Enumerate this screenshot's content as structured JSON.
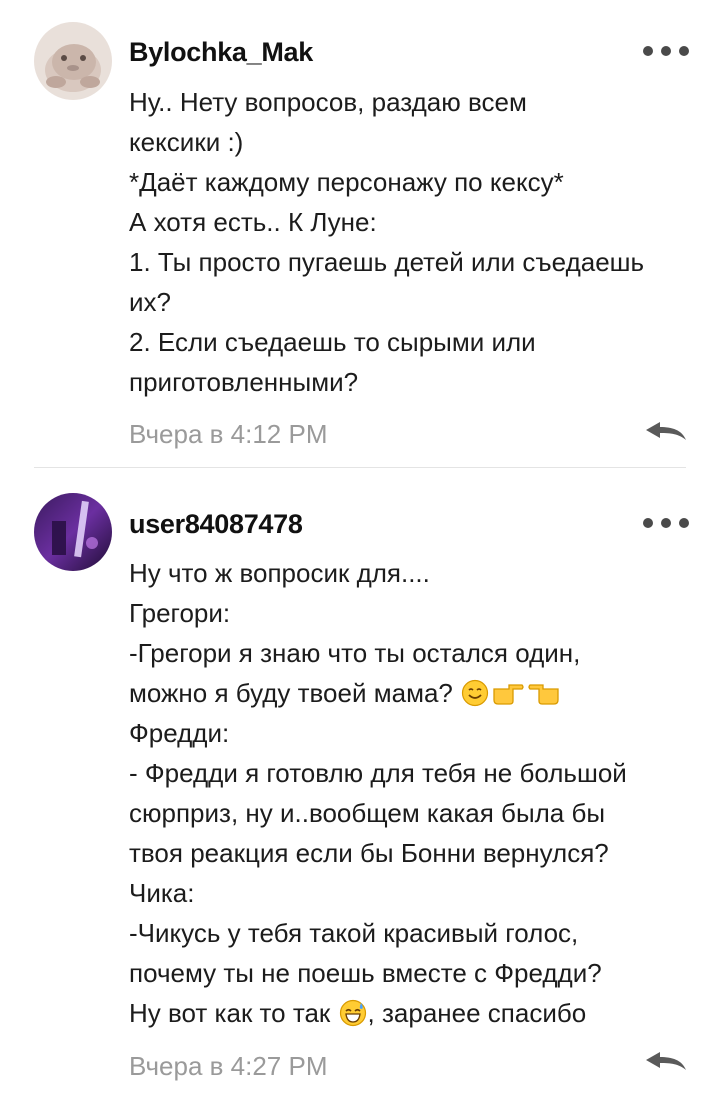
{
  "comments": [
    {
      "username": "Bylochka_Mak",
      "lines": [
        "Ну.. Нету вопросов, раздаю всем",
        "кексики :)",
        "*Даёт каждому персонажу по кексу*",
        "А хотя есть.. К Луне:",
        "1. Ты просто пугаешь детей или съедаешь",
        "их?",
        "2. Если съедаешь то сырыми или",
        "приготовленными?"
      ],
      "timestamp": "Вчера в 4:12 PM"
    },
    {
      "username": "user84087478",
      "lines": [
        "Ну что ж вопросик для....",
        "Грегори:",
        "-Грегори я знаю что ты остался один,",
        "можно я буду твоей мама?",
        "Фредди:",
        "- Фредди я готовлю для тебя не большой",
        "сюрприз, ну и..вообщем какая была бы",
        "твоя реакция если бы Бонни вернулся?",
        "Чика:",
        "-Чикусь у тебя такой красивый голос,",
        "почему ты не поешь вместе с Фредди?",
        "Ну вот как то так",
        ", заранее спасибо"
      ],
      "timestamp": "Вчера в 4:27 PM"
    }
  ],
  "icons": {
    "more": "more-dots-icon",
    "reply": "reply-arrow-icon",
    "emoji_smile": "smiling-face-emoji",
    "emoji_point_right": "pointing-right-emoji",
    "emoji_point_left": "pointing-left-emoji",
    "emoji_sweat": "grinning-sweat-emoji"
  },
  "colors": {
    "username": "#111111",
    "text": "#1c1c1c",
    "timestamp": "#9a9a9a",
    "icon": "#4a4a4a",
    "divider": "#e4e4e4"
  }
}
